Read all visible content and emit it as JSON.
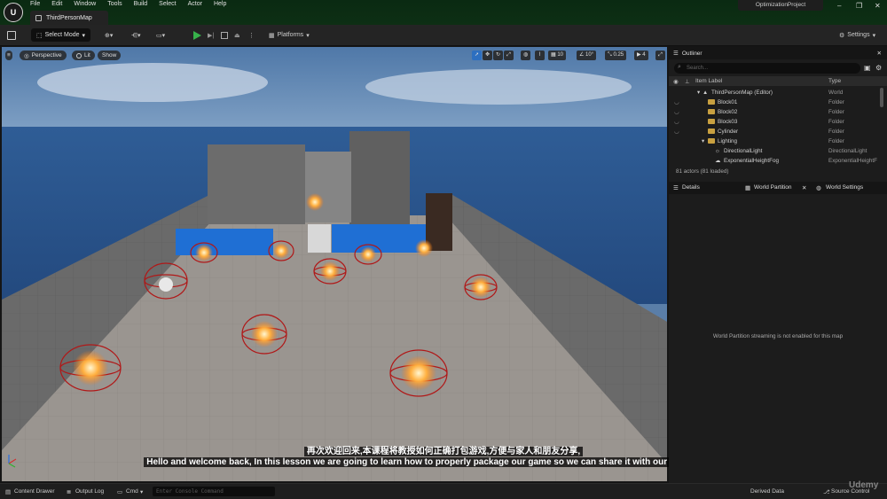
{
  "menu": [
    "File",
    "Edit",
    "Window",
    "Tools",
    "Build",
    "Select",
    "Actor",
    "Help"
  ],
  "document_tab": "ThirdPersonMap",
  "project_name": "OptimizationProject",
  "toolbar": {
    "mode": "Select Mode",
    "platforms": "Platforms",
    "settings": "Settings"
  },
  "viewport": {
    "view_mode_buttons": [
      "Perspective",
      "Lit",
      "Show"
    ],
    "grid_snap": "10",
    "rotation_snap": "10°",
    "scale_snap": "0.25",
    "camera_speed": "4"
  },
  "subtitles": {
    "chinese": "再次欢迎回来,本课程将教授如何正确打包游戏,方便与家人和朋友分享,",
    "english": "Hello and welcome back, In this lesson we are going to learn how to properly package our game so we can share it with our friends or family,"
  },
  "outliner": {
    "title": "Outliner",
    "search_placeholder": "Search...",
    "col_label": "Item Label",
    "col_type": "Type",
    "rows": [
      {
        "label": "ThirdPersonMap (Editor)",
        "type": "World"
      },
      {
        "label": "Block01",
        "type": "Folder"
      },
      {
        "label": "Block02",
        "type": "Folder"
      },
      {
        "label": "Block03",
        "type": "Folder"
      },
      {
        "label": "Cylinder",
        "type": "Folder"
      },
      {
        "label": "Lighting",
        "type": "Folder"
      },
      {
        "label": "DirectionalLight",
        "type": "DirectionalLight"
      },
      {
        "label": "ExponentialHeightFog",
        "type": "ExponentialHeightF"
      }
    ],
    "actor_count": "81 actors (81 loaded)"
  },
  "details": {
    "tabs": [
      "Details",
      "World Partition",
      "World Settings"
    ],
    "message": "World Partition streaming is not enabled for this map"
  },
  "statusbar": {
    "content_drawer": "Content Drawer",
    "output_log": "Output Log",
    "cmd": "Cmd",
    "console_placeholder": "Enter Console Command",
    "derived_data": "Derived Data",
    "source_control": "Source Control"
  },
  "watermark": "Udemy"
}
